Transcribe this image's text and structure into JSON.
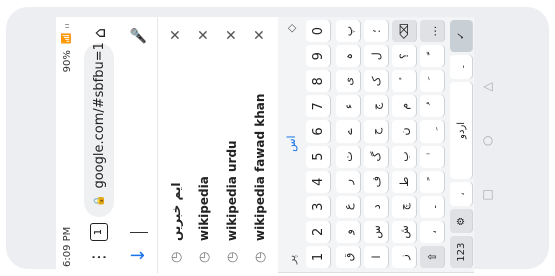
{
  "status": {
    "time": "6:09 PM",
    "battery": "90%",
    "signal": "📶 ᵢₗ"
  },
  "browser": {
    "url": "google.com/#sbfbu=1&",
    "menu": "⋮",
    "tabs_count": "1",
    "home": "⌂"
  },
  "search": {
    "back": "↓",
    "mic": "🎤"
  },
  "suggestions": [
    {
      "text": "ایم خبریں"
    },
    {
      "text": "wikipedia"
    },
    {
      "text": "wikipedia urdu"
    },
    {
      "text": "wikipedia fawad khan"
    }
  ],
  "keyboard": {
    "language_indicator": "اس",
    "emoji_key": "پر",
    "numbers": [
      "1",
      "2",
      "3",
      "4",
      "5",
      "6",
      "7",
      "8",
      "9",
      "0"
    ],
    "row1": [
      "ق",
      "و",
      "ع",
      "ر",
      "ت",
      "ے",
      "ء",
      "ی",
      "ہ",
      "پ"
    ],
    "row2": [
      "ا",
      "س",
      "د",
      "ف",
      "گ",
      "ح",
      "ج",
      "ک",
      "ل",
      "؛"
    ],
    "row3": [
      "ز",
      "ش",
      "چ",
      "ط",
      "ب",
      "ن",
      "م",
      "ٔ",
      "؟",
      "⌫"
    ],
    "bottom": {
      "mode": "123",
      "lang_label": "اردو",
      "enter": "✓"
    }
  },
  "nav": {
    "back": "◁",
    "home": "○",
    "recents": "□"
  }
}
